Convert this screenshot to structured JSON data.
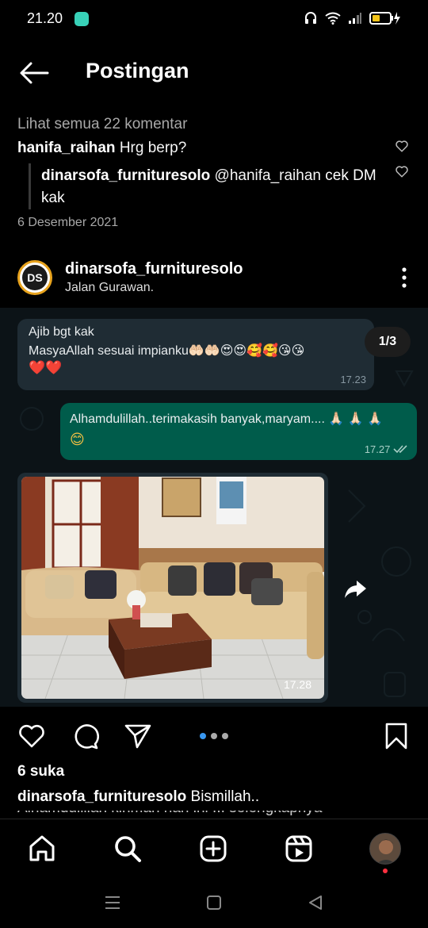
{
  "status_bar": {
    "time": "21.20"
  },
  "header": {
    "title": "Postingan"
  },
  "prev_post": {
    "view_comments": "Lihat semua 22 komentar",
    "comment": {
      "user": "hanifa_raihan",
      "text": "Hrg berp?"
    },
    "reply": {
      "user": "dinarsofa_furnituresolo",
      "mention": "@hanifa_raihan",
      "text": "cek DM kak"
    },
    "date": "6 Desember 2021"
  },
  "post": {
    "avatar_text": "DS",
    "username": "dinarsofa_furnituresolo",
    "location": "Jalan Gurawan.",
    "counter": "1/3",
    "image": {
      "msg_in": {
        "line1": "Ajib bgt kak",
        "line2": "MasyaAllah sesuai impianku🤲🏻🤲🏻😍😍🥰🥰😘😘",
        "emoji_line": "❤️❤️",
        "time": "17.23"
      },
      "msg_out": {
        "text": "Alhamdulillah..terimakasih banyak,maryam.... 🙏🏻 🙏🏻 🙏🏻",
        "emoji": "😊",
        "time": "17.27"
      },
      "photo_time": "17.28"
    },
    "likes": "6 suka",
    "caption_user": "dinarsofa_furnituresolo",
    "caption_text": "Bismillah..",
    "caption_cut": "Alhamdulillah kiriman hari ini ... selengkapnya"
  },
  "icons": {
    "like": "heart-icon",
    "comment": "comment-icon",
    "share": "send-icon",
    "save": "bookmark-icon",
    "home": "home-icon",
    "search": "search-icon",
    "create": "plus-square-icon",
    "reels": "reels-icon"
  },
  "colors": {
    "background": "#000000",
    "wa_out_bubble": "#005c4b",
    "wa_in_bubble": "#1f2c34",
    "active_dot": "#3897f0"
  }
}
